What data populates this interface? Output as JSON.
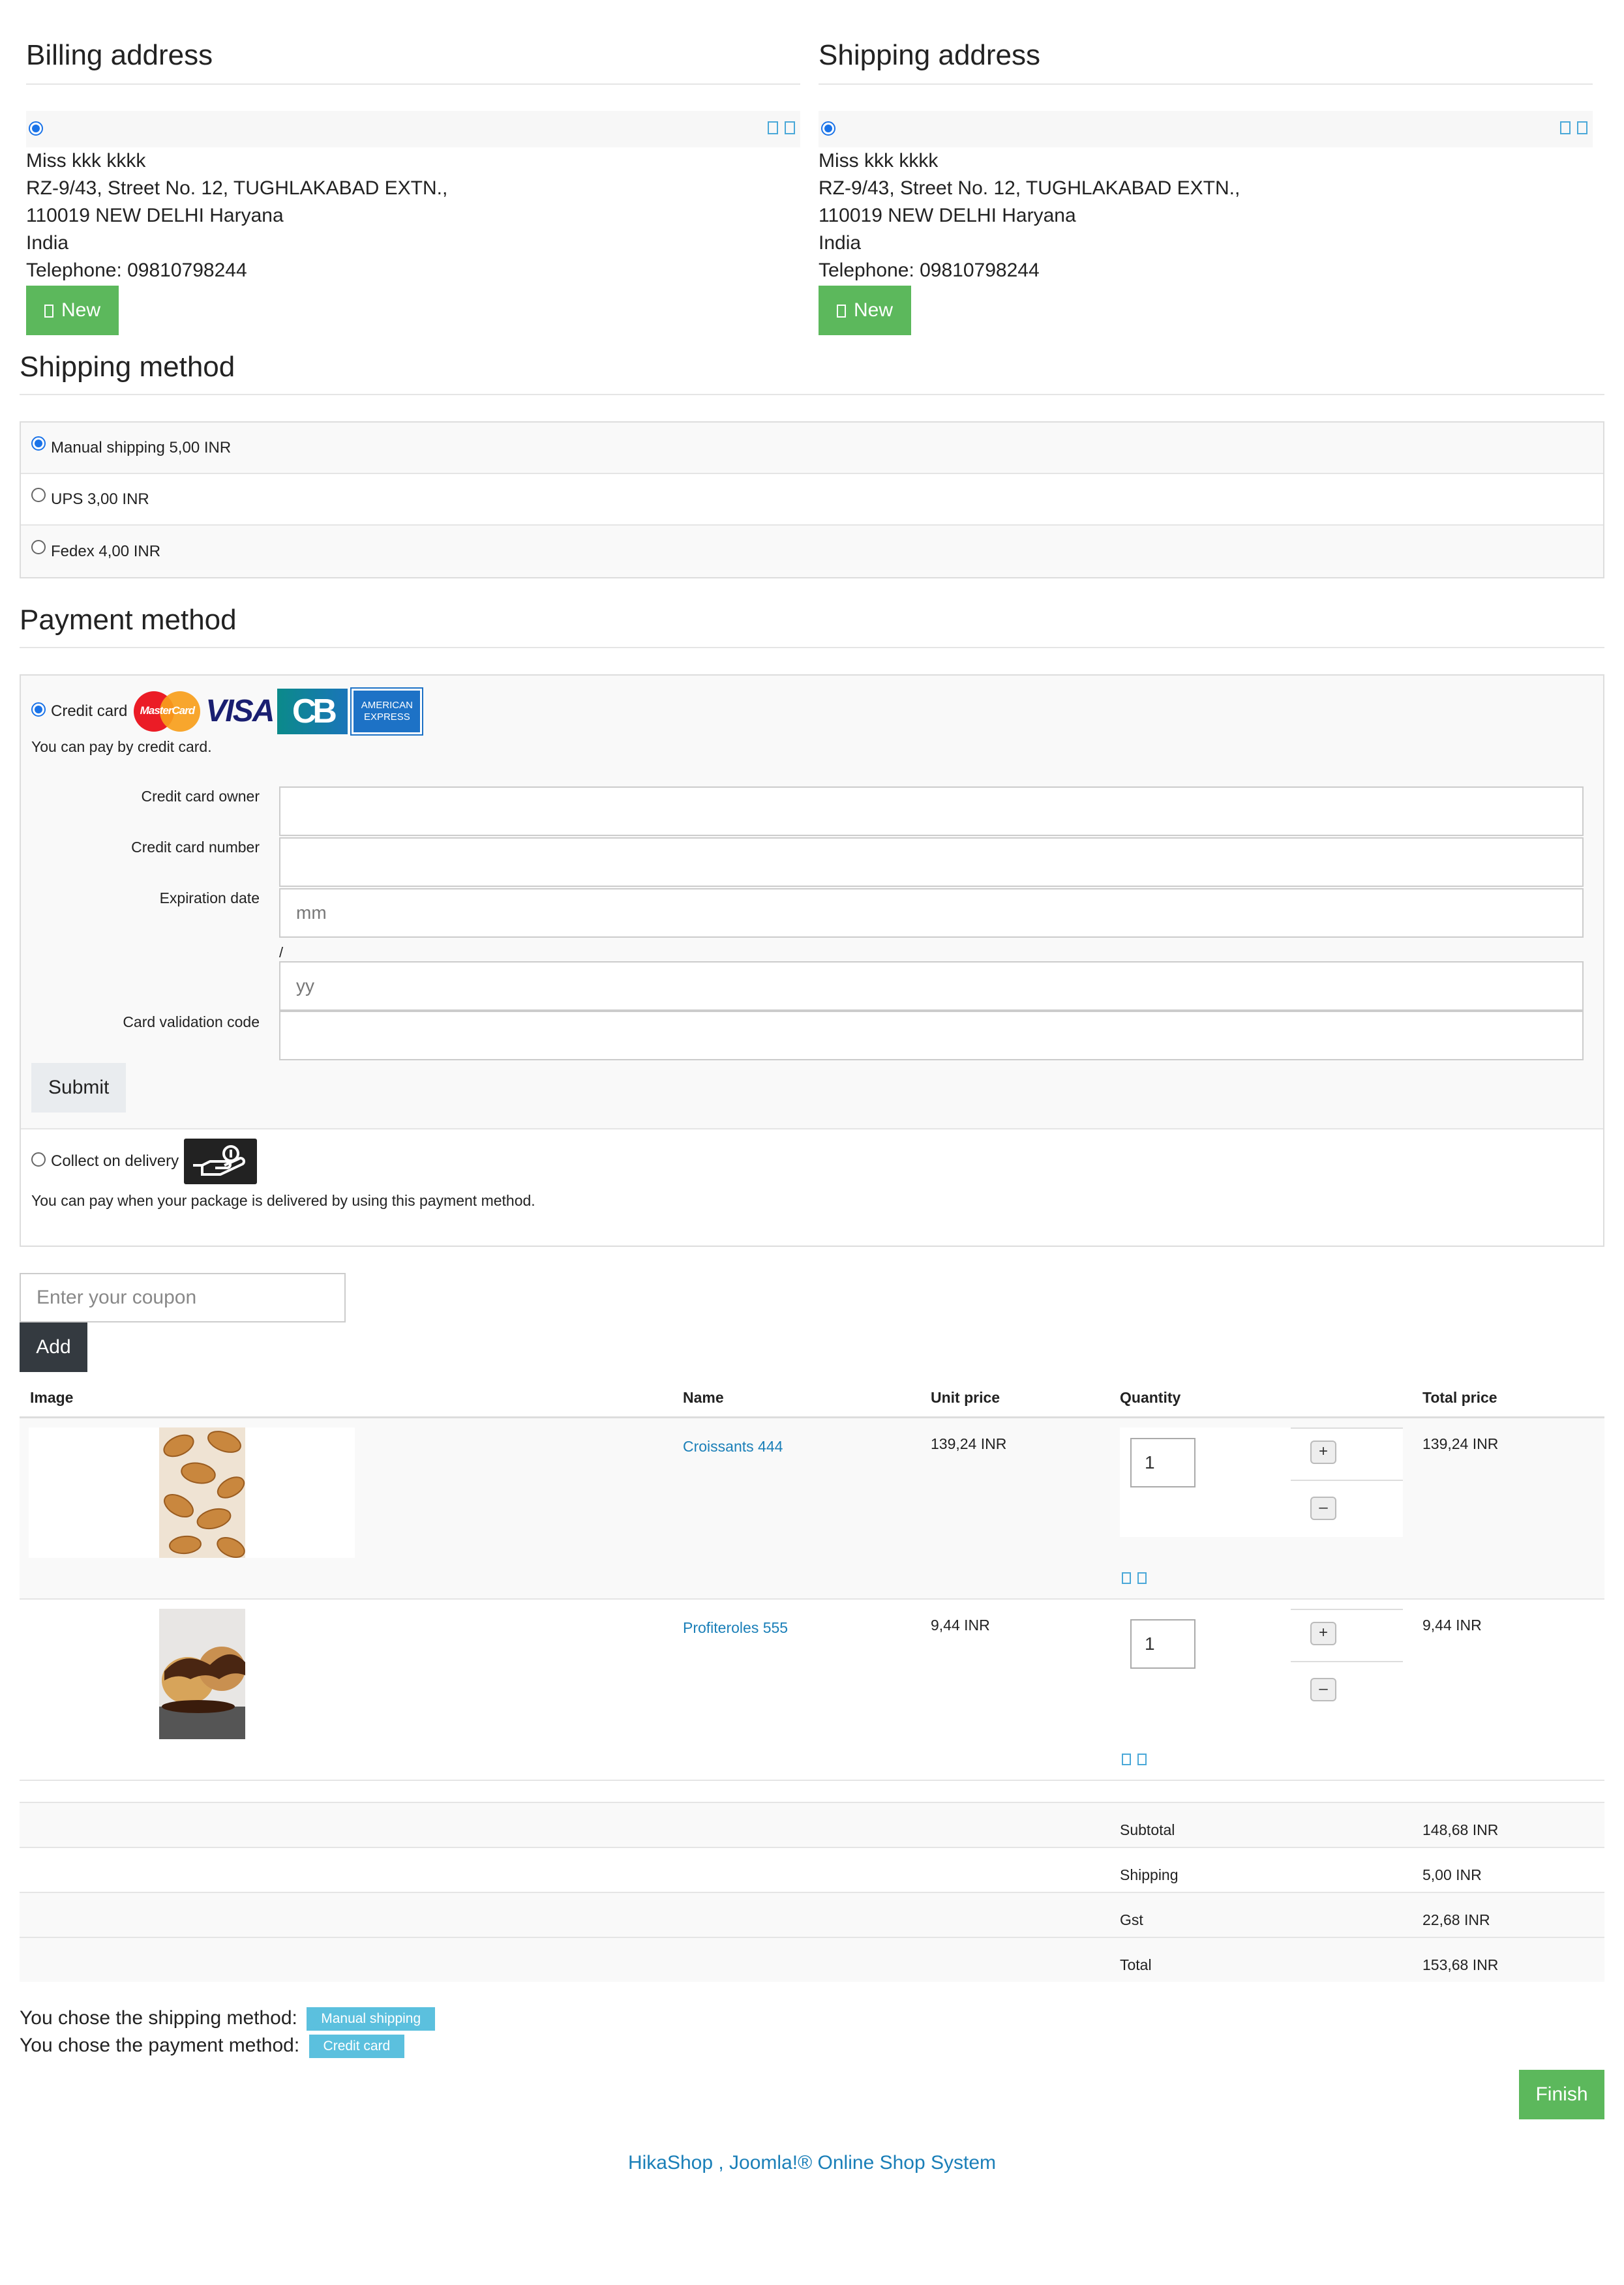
{
  "billing": {
    "title": "Billing address",
    "name": "Miss kkk kkkk",
    "street": "RZ-9/43, Street No. 12, TUGHLAKABAD EXTN.,",
    "city": "110019 NEW DELHI Haryana",
    "country": "India",
    "telephone": "Telephone: 09810798244",
    "new_label": "New"
  },
  "shipping_address": {
    "title": "Shipping address",
    "name": "Miss kkk kkkk",
    "street": "RZ-9/43, Street No. 12, TUGHLAKABAD EXTN.,",
    "city": "110019 NEW DELHI Haryana",
    "country": "India",
    "telephone": "Telephone: 09810798244",
    "new_label": "New"
  },
  "shipping_method": {
    "title": "Shipping method",
    "options": [
      {
        "label": "Manual shipping 5,00 INR",
        "selected": true
      },
      {
        "label": "UPS 3,00 INR",
        "selected": false
      },
      {
        "label": "Fedex 4,00 INR",
        "selected": false
      }
    ]
  },
  "payment_method": {
    "title": "Payment method",
    "credit_card": {
      "label": "Credit card",
      "description": "You can pay by credit card.",
      "logos": {
        "mastercard": "MasterCard",
        "visa": "VISA",
        "cb": "CB",
        "amex_line1": "AMERICAN",
        "amex_line2": "EXPRESS"
      },
      "fields": {
        "owner_label": "Credit card owner",
        "number_label": "Credit card number",
        "expiration_label": "Expiration date",
        "month_placeholder": "mm",
        "separator": "/",
        "year_placeholder": "yy",
        "cvv_label": "Card validation code"
      },
      "submit_label": "Submit"
    },
    "cod": {
      "label": "Collect on delivery",
      "description": "You can pay when your package is delivered by using this payment method."
    }
  },
  "coupon": {
    "placeholder": "Enter your coupon",
    "add_label": "Add"
  },
  "cart": {
    "headers": {
      "image": "Image",
      "name": "Name",
      "unit_price": "Unit price",
      "quantity": "Quantity",
      "total_price": "Total price"
    },
    "items": [
      {
        "name": "Croissants 444",
        "unit_price": "139,24 INR",
        "quantity": "1",
        "total": "139,24 INR"
      },
      {
        "name": "Profiteroles 555",
        "unit_price": "9,44 INR",
        "quantity": "1",
        "total": "9,44 INR"
      }
    ],
    "plus": "+",
    "minus": "–",
    "summary": [
      {
        "label": "Subtotal",
        "value": "148,68 INR"
      },
      {
        "label": "Shipping",
        "value": "5,00 INR"
      },
      {
        "label": "Gst",
        "value": "22,68 INR"
      },
      {
        "label": "Total",
        "value": "153,68 INR"
      }
    ]
  },
  "chosen": {
    "shipping_text": "You chose the shipping method:",
    "shipping_badge": "Manual shipping",
    "payment_text": "You chose the payment method:",
    "payment_badge": "Credit card"
  },
  "finish_label": "Finish",
  "footer": "HikaShop , Joomla!® Online Shop System"
}
